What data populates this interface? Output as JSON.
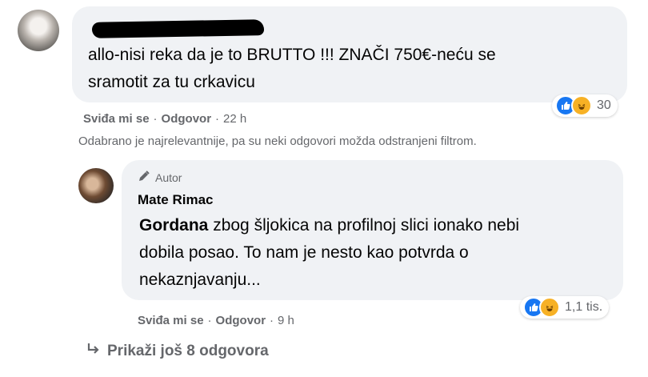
{
  "comment1": {
    "text_line1": "allo-nisi reka da je to BRUTTO !!! ZNAČI 750€-neću se",
    "text_line2": "sramotit za tu crkavicu",
    "reactions_count": "30",
    "like_label": "Sviđa mi se",
    "reply_label": "Odgovor",
    "time": "22 h"
  },
  "filter_note": "Odabrano je najrelevantnije, pa su neki odgovori možda odstranjeni filtrom.",
  "reply1": {
    "badge": "Autor",
    "author": "Mate Rimac",
    "mention": "Gordana",
    "text_line1": " zbog šljokica na profilnoj slici ionako nebi",
    "text_line2": "dobila posao. To nam je nesto kao potvrda o",
    "text_line3": "nekaznjavanju...",
    "reactions_count": "1,1 tis.",
    "like_label": "Sviđa mi se",
    "reply_label": "Odgovor",
    "time": "9 h"
  },
  "more_replies": "Prikaži još 8 odgovora",
  "colors": {
    "bubble": "#f0f2f5",
    "secondary_text": "#65676b",
    "like_blue": "#1877f2",
    "haha_yellow": "#f7b125"
  },
  "icons": [
    "like-icon",
    "haha-icon",
    "pencil-icon",
    "reply-arrow-icon"
  ]
}
